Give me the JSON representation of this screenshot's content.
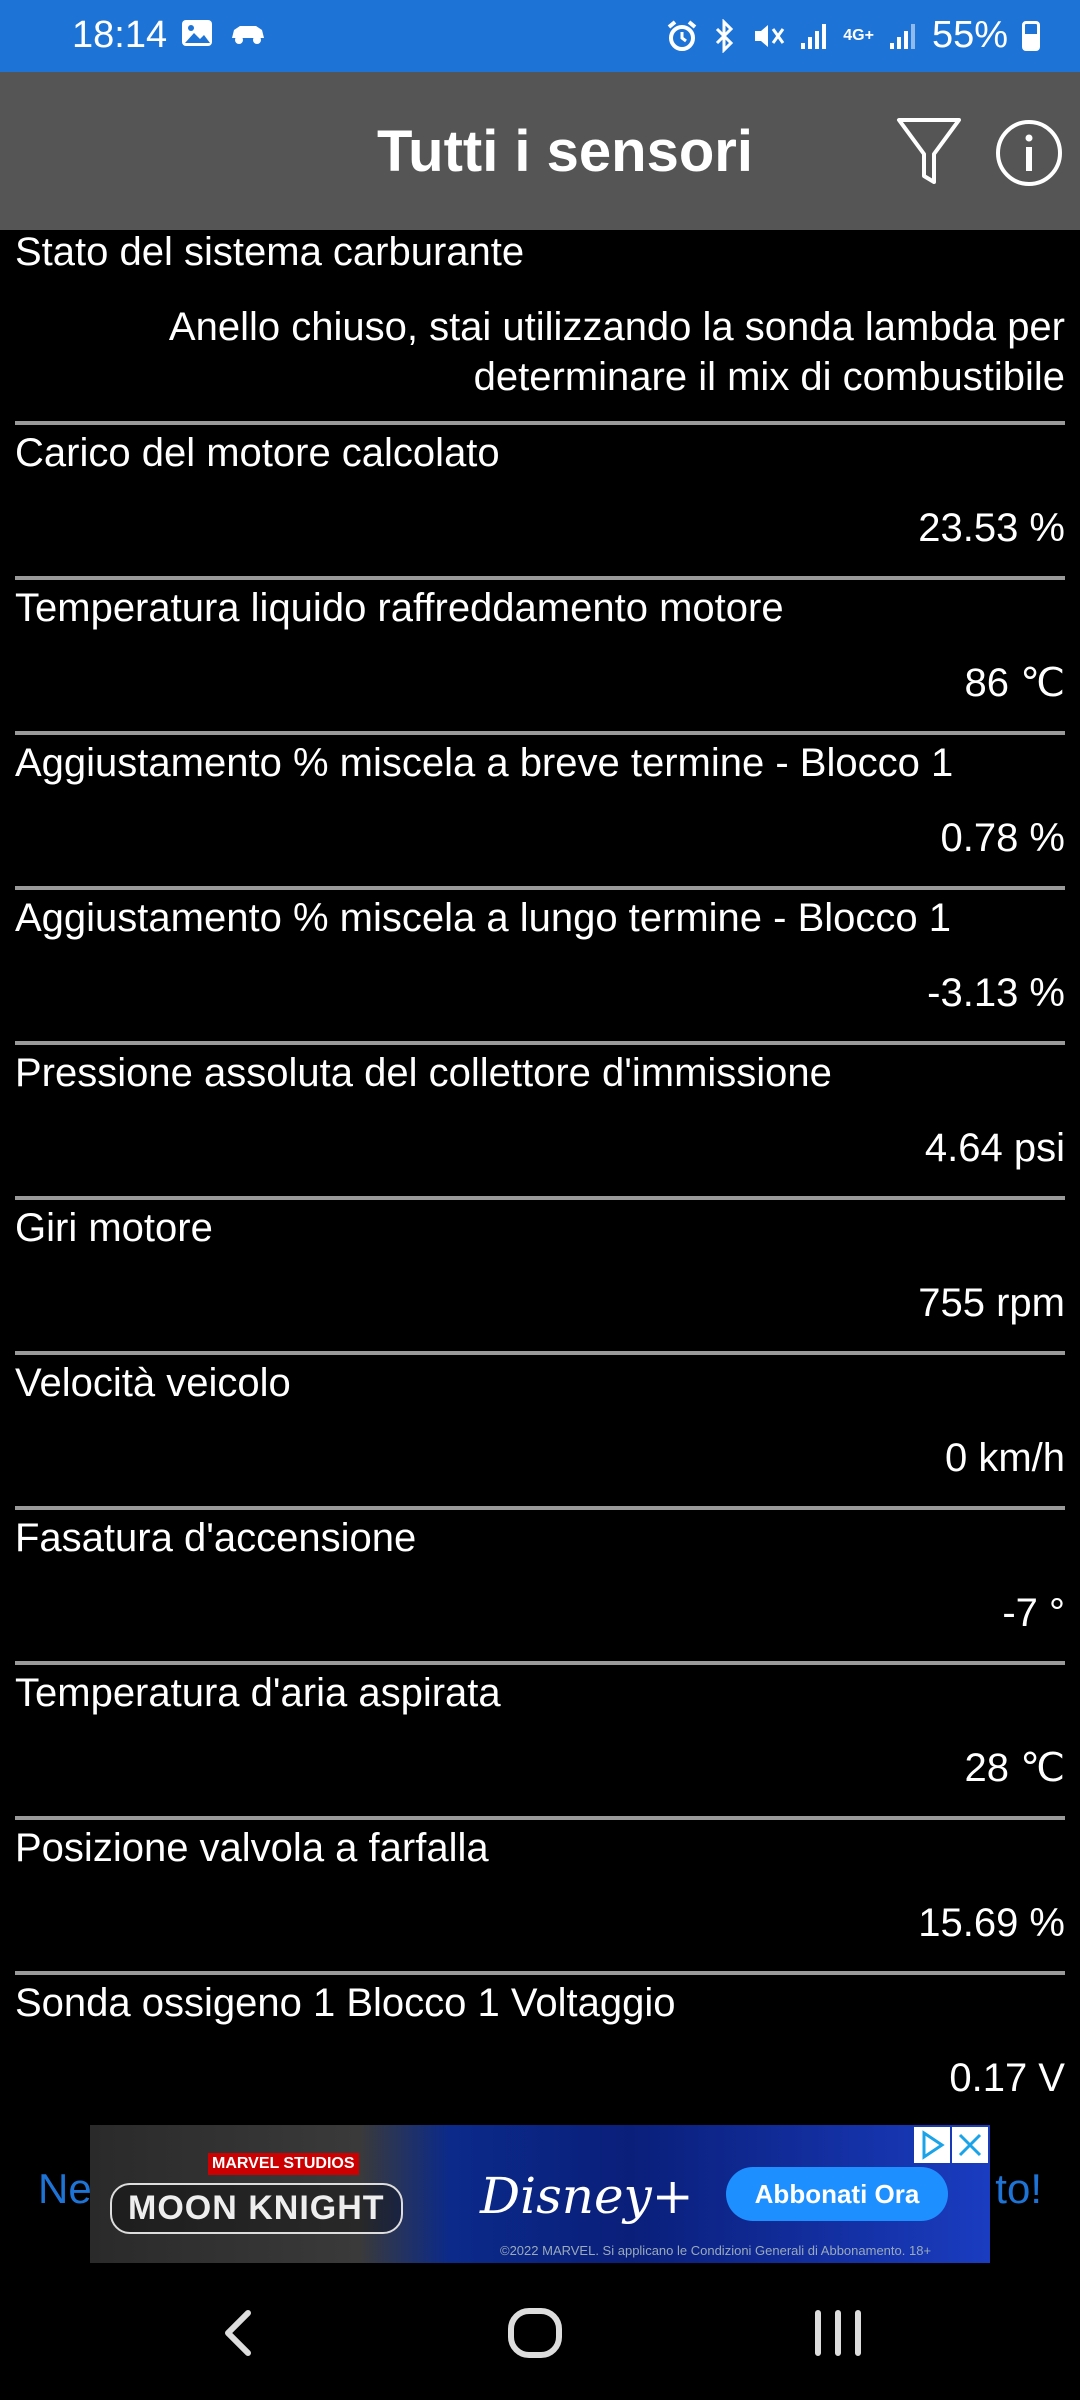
{
  "status_bar": {
    "time": "18:14",
    "battery": "55%",
    "battery_level": 0.55,
    "network": "4G+",
    "icons": [
      "gallery-icon",
      "car-icon",
      "alarm-icon",
      "bluetooth-icon",
      "mute-icon",
      "signal-icon",
      "signal-icon",
      "battery-icon"
    ]
  },
  "app_bar": {
    "title": "Tutti i sensori",
    "filter_icon": "filter-icon",
    "info_icon": "info-icon"
  },
  "sensors": [
    {
      "label": "Stato del sistema carburante",
      "value": "Anello chiuso, stai utilizzando la sonda lambda per determinare il mix di combustibile"
    },
    {
      "label": "Carico del motore calcolato",
      "value": "23.53 %"
    },
    {
      "label": "Temperatura liquido raffreddamento motore",
      "value": "86 ℃"
    },
    {
      "label": "Aggiustamento % miscela a breve termine - Blocco 1",
      "value": "0.78 %"
    },
    {
      "label": "Aggiustamento % miscela a lungo termine - Blocco 1",
      "value": "-3.13 %"
    },
    {
      "label": "Pressione assoluta del collettore d'immissione",
      "value": "4.64 psi"
    },
    {
      "label": "Giri motore",
      "value": "755 rpm"
    },
    {
      "label": "Velocità veicolo",
      "value": "0 km/h"
    },
    {
      "label": "Fasatura d'accensione",
      "value": "-7 °"
    },
    {
      "label": "Temperatura d'aria aspirata",
      "value": "28 ℃"
    },
    {
      "label": "Posizione valvola a farfalla",
      "value": "15.69 %"
    },
    {
      "label": "Sonda ossigeno 1 Blocco 1 Voltaggio",
      "value": "0.17 V"
    }
  ],
  "ad": {
    "left_peek": "Ne",
    "right_peek": "to!",
    "studio": "MARVEL STUDIOS",
    "title": "MOON KNIGHT",
    "brand": "Disney+",
    "cta": "Abbonati Ora",
    "legal": "©2022 MARVEL. Si applicano le Condizioni Generali di Abbonamento. 18+"
  },
  "nav_bar": {
    "back_icon": "back-icon",
    "home_icon": "home-icon",
    "recent_icon": "recent-apps-icon"
  }
}
